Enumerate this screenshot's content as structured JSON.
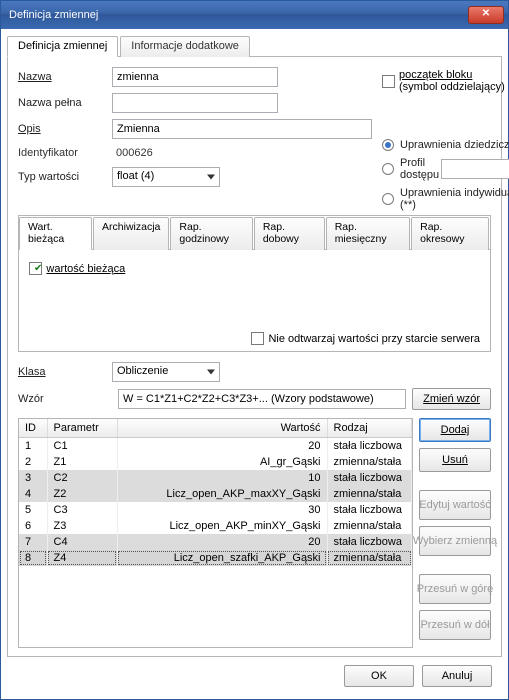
{
  "window_title": "Definicja zmiennej",
  "outer_tabs": [
    "Definicja zmiennej",
    "Informacje dodatkowe"
  ],
  "fields": {
    "nazwa_label": "Nazwa",
    "nazwa_value": "zmienna",
    "nazwa_pelna_label": "Nazwa pełna",
    "nazwa_pelna_value": "",
    "opis_label": "Opis",
    "opis_value": "Zmienna",
    "ident_label": "Identyfikator",
    "ident_value": "000626",
    "typ_label": "Typ wartości",
    "typ_value": "float (4)"
  },
  "start_block": {
    "label_line1": "początek bloku",
    "label_line2": "(symbol oddzielający)"
  },
  "perms": {
    "inherited": "Uprawnienia dziedziczone (*)",
    "profile": "Profil dostępu",
    "individual": "Uprawnienia indywidualne (**)"
  },
  "inner_tabs": [
    "Wart. bieżąca",
    "Archiwizacja",
    "Rap. godzinowy",
    "Rap. dobowy",
    "Rap. miesięczny",
    "Rap. okresowy"
  ],
  "inner": {
    "checkbox_label": "wartość bieżąca",
    "no_restore": "Nie odtwarzaj wartości przy starcie serwera"
  },
  "klasa_label": "Klasa",
  "klasa_value": "Obliczenie",
  "wzor_label": "Wzór",
  "wzor_value": "W = C1*Z1+C2*Z2+C3*Z3+... (Wzory podstawowe)",
  "zmien_wzor": "Zmień wzór",
  "grid": {
    "headers": {
      "id": "ID",
      "param": "Parametr",
      "value": "Wartość",
      "kind": "Rodzaj"
    },
    "rows": [
      {
        "id": "1",
        "param": "C1",
        "value": "20",
        "kind": "stała liczbowa"
      },
      {
        "id": "2",
        "param": "Z1",
        "value": "AI_gr_Gąski",
        "kind": "zmienna/stała"
      },
      {
        "id": "3",
        "param": "C2",
        "value": "10",
        "kind": "stała liczbowa"
      },
      {
        "id": "4",
        "param": "Z2",
        "value": "Licz_open_AKP_maxXY_Gąski",
        "kind": "zmienna/stała"
      },
      {
        "id": "5",
        "param": "C3",
        "value": "30",
        "kind": "stała liczbowa"
      },
      {
        "id": "6",
        "param": "Z3",
        "value": "Licz_open_AKP_minXY_Gąski",
        "kind": "zmienna/stała"
      },
      {
        "id": "7",
        "param": "C4",
        "value": "20",
        "kind": "stała liczbowa"
      },
      {
        "id": "8",
        "param": "Z4",
        "value": "Licz_open_szafki_AKP_Gąski",
        "kind": "zmienna/stała"
      }
    ]
  },
  "side": {
    "add": "Dodaj",
    "delete": "Usuń",
    "edit": "Edytuj wartość",
    "select": "Wybierz zmienną",
    "up": "Przesuń w górę",
    "down": "Przesuń w dół"
  },
  "dlg": {
    "ok": "OK",
    "cancel": "Anuluj"
  }
}
